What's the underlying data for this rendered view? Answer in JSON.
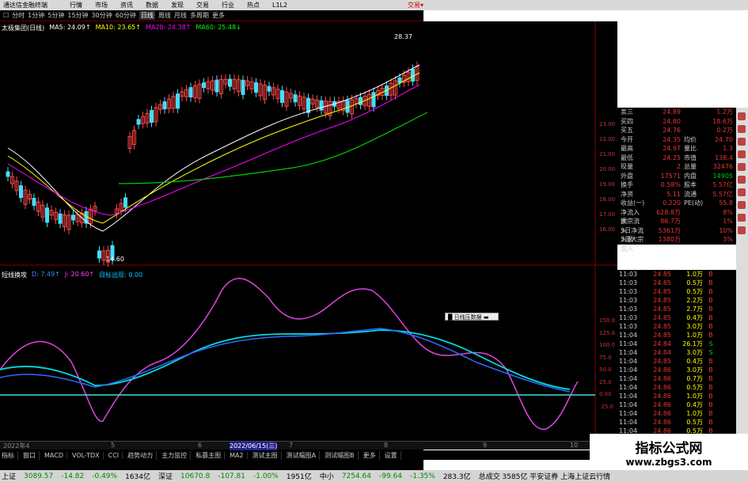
{
  "titlebar": {
    "app": "通达信金融终端",
    "menu": [
      "行情",
      "市场",
      "资讯",
      "数据",
      "发现",
      "交易",
      "行业",
      "热点",
      "L1L2"
    ],
    "brand": "交易▾"
  },
  "toolbar": [
    "☐",
    "分时",
    "1分钟",
    "5分钟",
    "15分钟",
    "30分钟",
    "60分钟",
    "日线",
    "周线",
    "月线",
    "多周期",
    "更多"
  ],
  "ma_legend": {
    "name": "太极集团(日线)",
    "items": [
      {
        "label": "MA5: 24.09↑",
        "color": "#ffffff"
      },
      {
        "label": "MA10: 23.65↑",
        "color": "#ffff00"
      },
      {
        "label": "MA20: 24.38↑",
        "color": "#ff00ff"
      },
      {
        "label": "MA60: 25.48↓",
        "color": "#00ff00"
      }
    ]
  },
  "price_labels": {
    "high": "28.37",
    "low": "14.60"
  },
  "price_axis": [
    "23.00",
    "22.00",
    "21.00",
    "20.00",
    "19.00",
    "18.00",
    "17.00",
    "16.00"
  ],
  "sub_legend": {
    "name": "短线换攻",
    "items": [
      {
        "label": "D: 7.49↑",
        "color": "#4488ff"
      },
      {
        "label": "J: 20.60↑",
        "color": "#ff44ff"
      },
      {
        "label": "目标出现: 0.00",
        "color": "#00ccff"
      }
    ]
  },
  "sub_axis": [
    "150.0",
    "125.0",
    "100.0",
    "75.0",
    "50.0",
    "25.0",
    "0.00",
    "-25.0"
  ],
  "tip": "█ 日线压数据 ▬",
  "quote": [
    {
      "k": "卖三",
      "v": "24.89",
      "k2": "",
      "v2": "1.2万"
    },
    {
      "k": "买四",
      "v": "24.80",
      "k2": "",
      "v2": "18.6万"
    },
    {
      "k": "买五",
      "v": "24.76",
      "k2": "",
      "v2": "0.2万"
    },
    {
      "k": "今开",
      "v": "24.35",
      "k2": "均价",
      "v2": "24.70"
    },
    {
      "k": "最高",
      "v": "24.97",
      "k2": "量比",
      "v2": "1.3"
    },
    {
      "k": "最低",
      "v": "24.25",
      "k2": "市值",
      "v2": "138.4"
    },
    {
      "k": "现量",
      "v": "2",
      "k2": "总量",
      "v2": "32476"
    },
    {
      "k": "外盘",
      "v": "17571",
      "k2": "内盘",
      "v2": "14905"
    },
    {
      "k": "换手",
      "v": "0.58%",
      "k2": "股本",
      "v2": "5.57亿"
    },
    {
      "k": "净资",
      "v": "5.11",
      "k2": "流通",
      "v2": "5.57亿"
    },
    {
      "k": "收益(一)",
      "v": "0.220",
      "k2": "PE(动)",
      "v2": "55.8"
    },
    {
      "k": "净流入额",
      "v": "628.8万",
      "k2": "",
      "v2": "8%"
    },
    {
      "k": "大宗流入",
      "v": "86.7万",
      "k2": "",
      "v2": "1%"
    },
    {
      "k": "5日净流入额",
      "v": "5361万",
      "k2": "",
      "v2": "10%"
    },
    {
      "k": "5日大宗流入",
      "v": "1380万",
      "k2": "",
      "v2": "3%"
    }
  ],
  "trades": [
    {
      "t": "11:03",
      "p": "24.85",
      "v": "1.0万",
      "bs": "B"
    },
    {
      "t": "11:03",
      "p": "24.85",
      "v": "0.5万",
      "bs": "B"
    },
    {
      "t": "11:03",
      "p": "24.85",
      "v": "0.5万",
      "bs": "B"
    },
    {
      "t": "11:03",
      "p": "24.85",
      "v": "2.2万",
      "bs": "B"
    },
    {
      "t": "11:03",
      "p": "24.85",
      "v": "2.7万",
      "bs": "B"
    },
    {
      "t": "11:03",
      "p": "24.85",
      "v": "0.4万",
      "bs": "B"
    },
    {
      "t": "11:03",
      "p": "24.85",
      "v": "3.0万",
      "bs": "B"
    },
    {
      "t": "11:04",
      "p": "24.85",
      "v": "1.0万",
      "bs": "B"
    },
    {
      "t": "11:04",
      "p": "24.84",
      "v": "26.1万",
      "bs": "S"
    },
    {
      "t": "11:04",
      "p": "24.84",
      "v": "3.0万",
      "bs": "S"
    },
    {
      "t": "11:04",
      "p": "24.85",
      "v": "0.4万",
      "bs": "B"
    },
    {
      "t": "11:04",
      "p": "24.86",
      "v": "3.0万",
      "bs": "B"
    },
    {
      "t": "11:04",
      "p": "24.86",
      "v": "0.7万",
      "bs": "B"
    },
    {
      "t": "11:04",
      "p": "24.86",
      "v": "0.5万",
      "bs": "B"
    },
    {
      "t": "11:04",
      "p": "24.86",
      "v": "1.0万",
      "bs": "B"
    },
    {
      "t": "11:04",
      "p": "24.86",
      "v": "0.4万",
      "bs": "B"
    },
    {
      "t": "11:04",
      "p": "24.86",
      "v": "1.0万",
      "bs": "B"
    },
    {
      "t": "11:04",
      "p": "24.86",
      "v": "0.5万",
      "bs": "B"
    },
    {
      "t": "11:04",
      "p": "24.86",
      "v": "0.5万",
      "bs": "B"
    }
  ],
  "date_axis": [
    "2022年4",
    "5",
    "6",
    "2022/06/15(三)",
    "7",
    "8",
    "9",
    "10"
  ],
  "indicator_tabs": [
    "指标",
    "窗口",
    "MACD",
    "VOL-TDX",
    "CCI",
    "趋势动力",
    "主力监控",
    "私募主图",
    "MA2",
    "测试主图",
    "测试幅图A",
    "测试幅图B",
    "更多",
    "设置"
  ],
  "status": [
    {
      "label": "上证",
      "v": "3089.57",
      "c": "-14.82",
      "p": "-0.49%",
      "a": "1634亿"
    },
    {
      "label": "深证",
      "v": "10670.8",
      "c": "-107.81",
      "p": "-1.00%",
      "a": "1951亿"
    },
    {
      "label": "中小",
      "v": "7254.64",
      "c": "-99.64",
      "p": "-1.35%",
      "a": "283.3亿"
    }
  ],
  "status_extra": "总成交 3585亿   平安证券 上海上证云行情",
  "watermark": {
    "title": "指标公式网",
    "url": "www.zbgs3.com"
  }
}
